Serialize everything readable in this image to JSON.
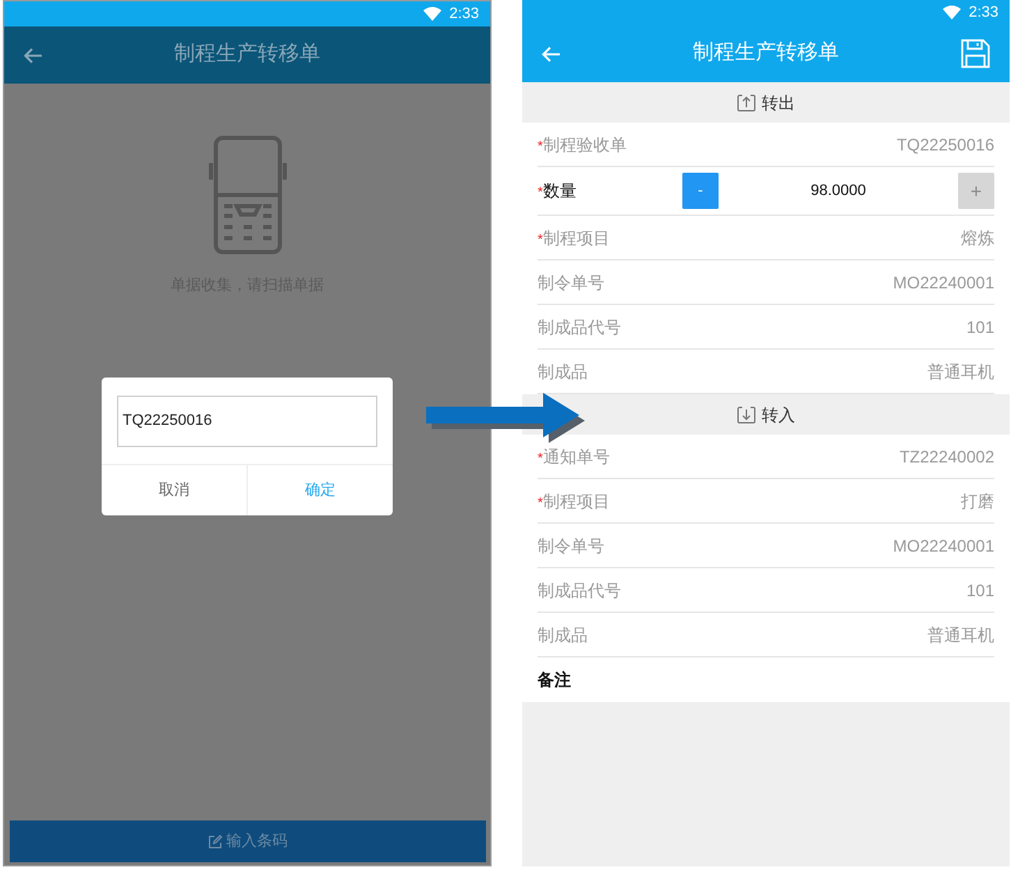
{
  "required_mark": "*",
  "scan_screen": {
    "status_time": "2:33",
    "title": "制程生产转移单",
    "hint": "单据收集，请扫描单据",
    "dialog": {
      "input_value": "TQ22250016",
      "buttons": [
        {
          "label": "取消",
          "primary": false
        },
        {
          "label": "确定",
          "primary": true
        }
      ]
    },
    "bottom_button": "输入条码"
  },
  "form_screen": {
    "status_time": "2:33",
    "title": "制程生产转移单",
    "sections": [
      {
        "title": "转出",
        "kind": "out",
        "rows": [
          {
            "kind": "field",
            "label": "制程验收单",
            "required": true,
            "value": "TQ22250016"
          },
          {
            "kind": "stepper",
            "label": "数量",
            "required": true,
            "value": "98.0000",
            "minus": {
              "label": "-",
              "disabled": false
            },
            "plus": {
              "label": "+",
              "disabled": true
            }
          },
          {
            "kind": "field",
            "label": "制程项目",
            "required": true,
            "value": "熔炼"
          },
          {
            "kind": "field",
            "label": "制令单号",
            "required": false,
            "value": "MO22240001"
          },
          {
            "kind": "field",
            "label": "制成品代号",
            "required": false,
            "value": "101"
          },
          {
            "kind": "field",
            "label": "制成品",
            "required": false,
            "value": "普通耳机"
          }
        ]
      },
      {
        "title": "转入",
        "kind": "in",
        "rows": [
          {
            "kind": "field",
            "label": "通知单号",
            "required": true,
            "value": "TZ22240002"
          },
          {
            "kind": "field",
            "label": "制程项目",
            "required": true,
            "value": "打磨"
          },
          {
            "kind": "field",
            "label": "制令单号",
            "required": false,
            "value": "MO22240001"
          },
          {
            "kind": "field",
            "label": "制成品代号",
            "required": false,
            "value": "101"
          },
          {
            "kind": "field",
            "label": "制成品",
            "required": false,
            "value": "普通耳机"
          },
          {
            "kind": "note",
            "label": "备注",
            "required": false
          }
        ]
      }
    ]
  }
}
